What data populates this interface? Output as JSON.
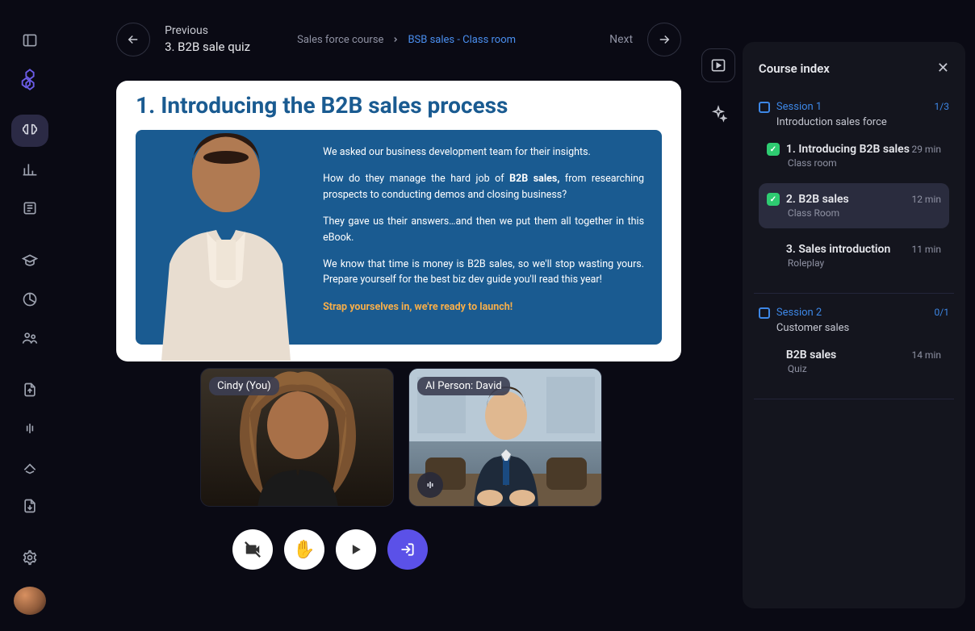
{
  "header": {
    "prev_label": "Previous",
    "prev_title": "3. B2B sale quiz",
    "breadcrumb_root": "Sales force course",
    "breadcrumb_current": "BSB sales - Class room",
    "next_label": "Next"
  },
  "slide": {
    "title": "1. Introducing the B2B sales process",
    "p1": "We asked our business development team for their insights.",
    "p2a": "How do they manage the hard job of ",
    "p2b": "B2B sales,",
    "p2c": " from researching prospects to conducting demos and closing business?",
    "p3": "They gave us their answers…and then we put them all together in this eBook.",
    "p4": "We know that time is money is B2B sales, so we'll stop wasting yours. Prepare yourself for the best biz dev guide you'll read this year!",
    "launch": "Strap yourselves in, we're ready to launch!"
  },
  "video": {
    "you_label": "Cindy (You)",
    "ai_label": "AI Person: David"
  },
  "panel": {
    "title": "Course index",
    "sessions": [
      {
        "label": "Session 1",
        "sub": "Introduction sales force",
        "count": "1/3",
        "lessons": [
          {
            "title": "1.  Introducing B2B sales",
            "sub": "Class room",
            "dur": "29 min",
            "done": true
          },
          {
            "title": "2.  B2B sales",
            "sub": "Class Room",
            "dur": "12 min",
            "done": true,
            "selected": true
          },
          {
            "title": "3.  Sales introduction",
            "sub": "Roleplay",
            "dur": "11 min",
            "done": false
          }
        ]
      },
      {
        "label": "Session 2",
        "sub": "Customer sales",
        "count": "0/1",
        "lessons": [
          {
            "title": "B2B sales",
            "sub": "Quiz",
            "dur": "14 min",
            "done": false
          }
        ]
      }
    ]
  }
}
